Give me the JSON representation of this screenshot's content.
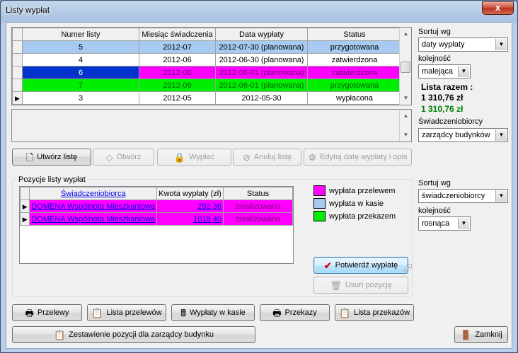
{
  "window": {
    "title": "Listy wypłat",
    "close_glyph": "x"
  },
  "top_grid": {
    "columns": [
      "Numer listy",
      "Miesiąc świadczenia",
      "Data wypłaty",
      "Status"
    ],
    "rows": [
      {
        "numer": "5",
        "miesiac": "2012-07",
        "data": "2012-07-30 (planowana)",
        "status": "przygotowana",
        "bg": "#a6caf0",
        "fg": "#000000",
        "current": false
      },
      {
        "numer": "4",
        "miesiac": "2012-06",
        "data": "2012-06-30 (planowana)",
        "status": "zatwierdzona",
        "bg": "#ffffff",
        "fg": "#000000",
        "current": false
      },
      {
        "numer": "6",
        "miesiac": "2012-06",
        "data": "2012-06-01 (planowana)",
        "status": "zatwierdzona",
        "bg": "#ff00ff",
        "fg": "#7a007a",
        "current": false,
        "num_bg": "#0033cc",
        "num_fg": "#ffffff"
      },
      {
        "numer": "7",
        "miesiac": "2012-06",
        "data": "2012-06-01 (planowana)",
        "status": "przygotowana",
        "bg": "#00ee00",
        "fg": "#006400",
        "current": false
      },
      {
        "numer": "3",
        "miesiac": "2012-05",
        "data": "2012-05-30",
        "status": "wypłacona",
        "bg": "#ffffff",
        "fg": "#000000",
        "current": true
      }
    ]
  },
  "sort_top": {
    "label": "Sortuj wg",
    "value": "daty wypłaty",
    "order_label": "kolejność",
    "order_value": "malejąca",
    "total_label": "Lista razem :",
    "total_value": "1 310,76 zł",
    "total_value_green": "1 310,76 zł",
    "color_total_green": "#008000",
    "beneficiary_label": "Świadczeniobiorcy",
    "beneficiary_value": "zarządcy budynków"
  },
  "toolbar": {
    "create": "Utwórz listę",
    "open": "Otwórz",
    "pay": "Wypłać",
    "cancel": "Anuluj listę",
    "edit_date": "Edytuj datę wypłaty i opis"
  },
  "positions": {
    "group_title": "Pozycje listy wypłat",
    "columns": [
      "Świadczeniobiorca",
      "Kwota wypłaty (zł)",
      "Status"
    ],
    "rows": [
      {
        "name": "DOMENA Wspólnota Mieszkaniowa",
        "amount": "292,36",
        "status": "zrealizowana"
      },
      {
        "name": "DOMENA Wspólnota Mieszkaniowa",
        "amount": "1018,40",
        "status": "zrealizowana"
      }
    ],
    "row_color": "#ff00ff"
  },
  "legend": [
    {
      "label": "wypłata przelewem",
      "color": "#ff00ff"
    },
    {
      "label": "wypłata w kasie",
      "color": "#a6caf0"
    },
    {
      "label": "wypłata przekazem",
      "color": "#00ee00"
    }
  ],
  "actions": {
    "confirm": "Potwierdź wypłatę",
    "remove": "Usuń pozycję"
  },
  "sort_bottom": {
    "label": "Sortuj wg",
    "value": "świadczeniobiorcy",
    "order_label": "kolejność",
    "order_value": "rosnąca"
  },
  "bottom": {
    "transfers": "Przelewy",
    "transfer_list": "Lista przelewów",
    "cash_payments": "Wypłaty w kasie",
    "money_orders": "Przekazy",
    "money_order_list": "Lista przekazów",
    "summary": "Zestawienie pozycji dla zarządcy budynku",
    "close": "Zamknij"
  }
}
